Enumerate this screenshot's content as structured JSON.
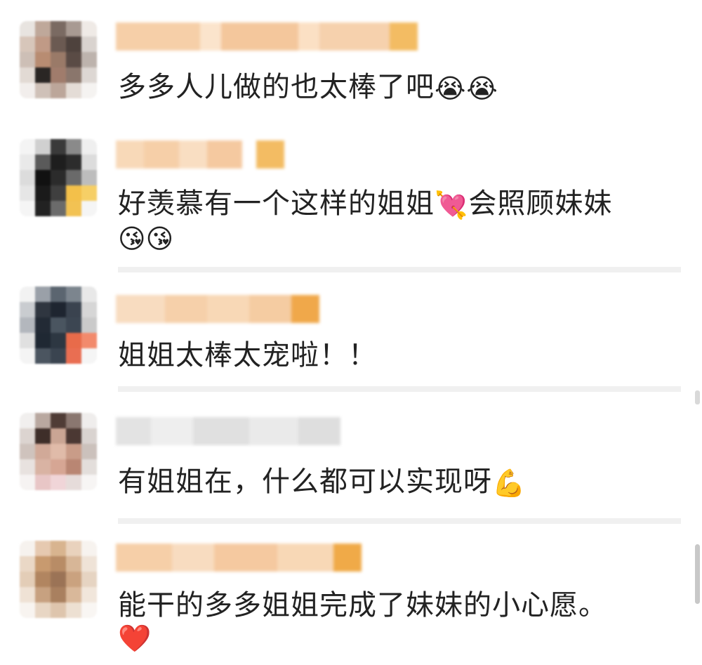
{
  "comments": [
    {
      "text": "多多人儿做的也太棒了吧",
      "emojis": [
        "😭",
        "😭"
      ],
      "colors": {
        "emoji": "#f5a623"
      }
    },
    {
      "text": "好羡慕有一个这样的姐姐",
      "emoji_mid": "💘",
      "text_after": "会照顾妹妹",
      "emojis": [
        "😘",
        "😘"
      ]
    },
    {
      "text": "姐姐太棒太宠啦！！"
    },
    {
      "text": "有姐姐在，什么都可以实现呀",
      "emojis": [
        "💪"
      ]
    },
    {
      "text": "能干的多多姐姐完成了妹妹的小心愿。",
      "emojis": [
        "❤️"
      ]
    }
  ],
  "colors": {
    "background": "#ffffff",
    "text": "#222222",
    "name_blur": "#f6cfa8",
    "badge": "#f3bc63",
    "divider": "#f0f0f0"
  }
}
